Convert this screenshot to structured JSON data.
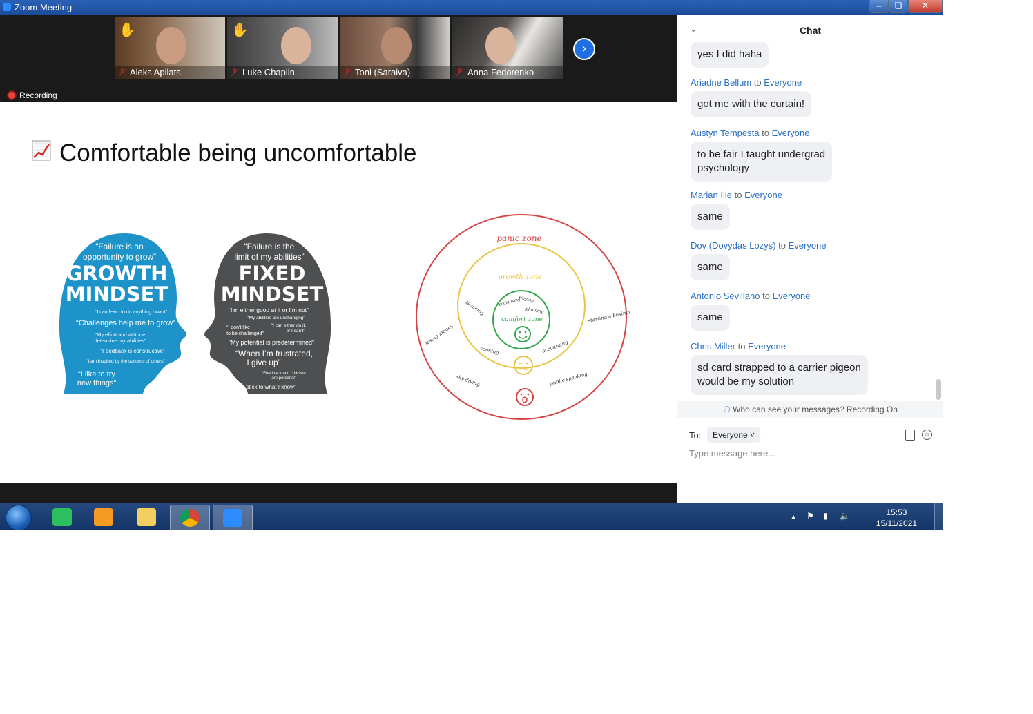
{
  "window": {
    "title": "Zoom Meeting"
  },
  "participants": [
    {
      "name": "Aleks Apilats",
      "hand": true
    },
    {
      "name": "Luke Chaplin",
      "hand": true
    },
    {
      "name": "Toni (Saraiva)",
      "hand": false
    },
    {
      "name": "Anna Fedorenko",
      "hand": false
    }
  ],
  "recording": {
    "label": "Recording"
  },
  "slide": {
    "title": "Comfortable being uncomfortable",
    "growth": {
      "quote1": "“Failure is an",
      "quote2": "opportunity to grow”",
      "head1": "GROWTH",
      "head2": "MINDSET",
      "l1": "“I can learn to do anything I want”",
      "l2": "“Challenges help me to grow”",
      "l3": "“My effort and attitude",
      "l4": "determine my abilities”",
      "l5": "“Feedback is constructive”",
      "l6": "“I am inspired by the success of others”",
      "l7": "“I like to try",
      "l8": "new things”"
    },
    "fixed": {
      "quote1": "“Failure is the",
      "quote2": "limit of my abilities”",
      "head1": "FIXED",
      "head2": "MINDSET",
      "l1": "“I’m either good at it or I’m not”",
      "l2": "“My abilities are unchanging”",
      "l3": "“I don’t like",
      "l4": "to be challenged”",
      "l5": "“I can either do it,",
      "l6": "or I can’t”",
      "l7": "“My potential is predetermined”",
      "l8": "“When I’m frustrated,",
      "l9": "I give up”",
      "l10": "“Feedback and criticism",
      "l11": "are personal”",
      "l12": "“I stick to what I know”"
    },
    "zones": {
      "panic": "panic zone",
      "growth": "growth zone",
      "comfort": "comfort zone",
      "items": [
        "teaching",
        "socialising",
        "singing",
        "planning",
        "losing money",
        "starting a business",
        "cooking",
        "accounting",
        "sky diving",
        "public speaking"
      ]
    }
  },
  "chat": {
    "title": "Chat",
    "messages": [
      {
        "sender": "",
        "to": "",
        "recipient": "",
        "text": "yes I did haha"
      },
      {
        "sender": "Ariadne Bellum",
        "to": "to",
        "recipient": "Everyone",
        "text": "got me with the curtain!"
      },
      {
        "sender": "Austyn Tempesta",
        "to": "to",
        "recipient": "Everyone",
        "text1": "to be fair I taught undergrad",
        "text2": "psychology"
      },
      {
        "sender": "Marian Ilie",
        "to": "to",
        "recipient": "Everyone",
        "text": "same"
      },
      {
        "sender": "Dov (Dovydas Lozys)",
        "to": "to",
        "recipient": "Everyone",
        "text": "same"
      },
      {
        "sender": "Antonio Sevillano",
        "to": "to",
        "recipient": "Everyone",
        "text": "same"
      },
      {
        "sender": "Chris Miller",
        "to": "to",
        "recipient": "Everyone",
        "text1": "sd card strapped to a carrier pigeon",
        "text2": "would be my solution"
      }
    ],
    "privacy": "Who can see your messages? Recording On",
    "to_label": "To:",
    "to_value": "Everyone",
    "placeholder": "Type message here..."
  },
  "taskbar": {
    "time": "15:53",
    "date": "15/11/2021"
  },
  "colors": {
    "accent": "#2d8cff",
    "growth_head": "#1e93c9",
    "fixed_head": "#4d4f51",
    "panic_ring": "#d64545",
    "growth_ring": "#e9c547",
    "comfort_ring": "#2fa64a"
  }
}
